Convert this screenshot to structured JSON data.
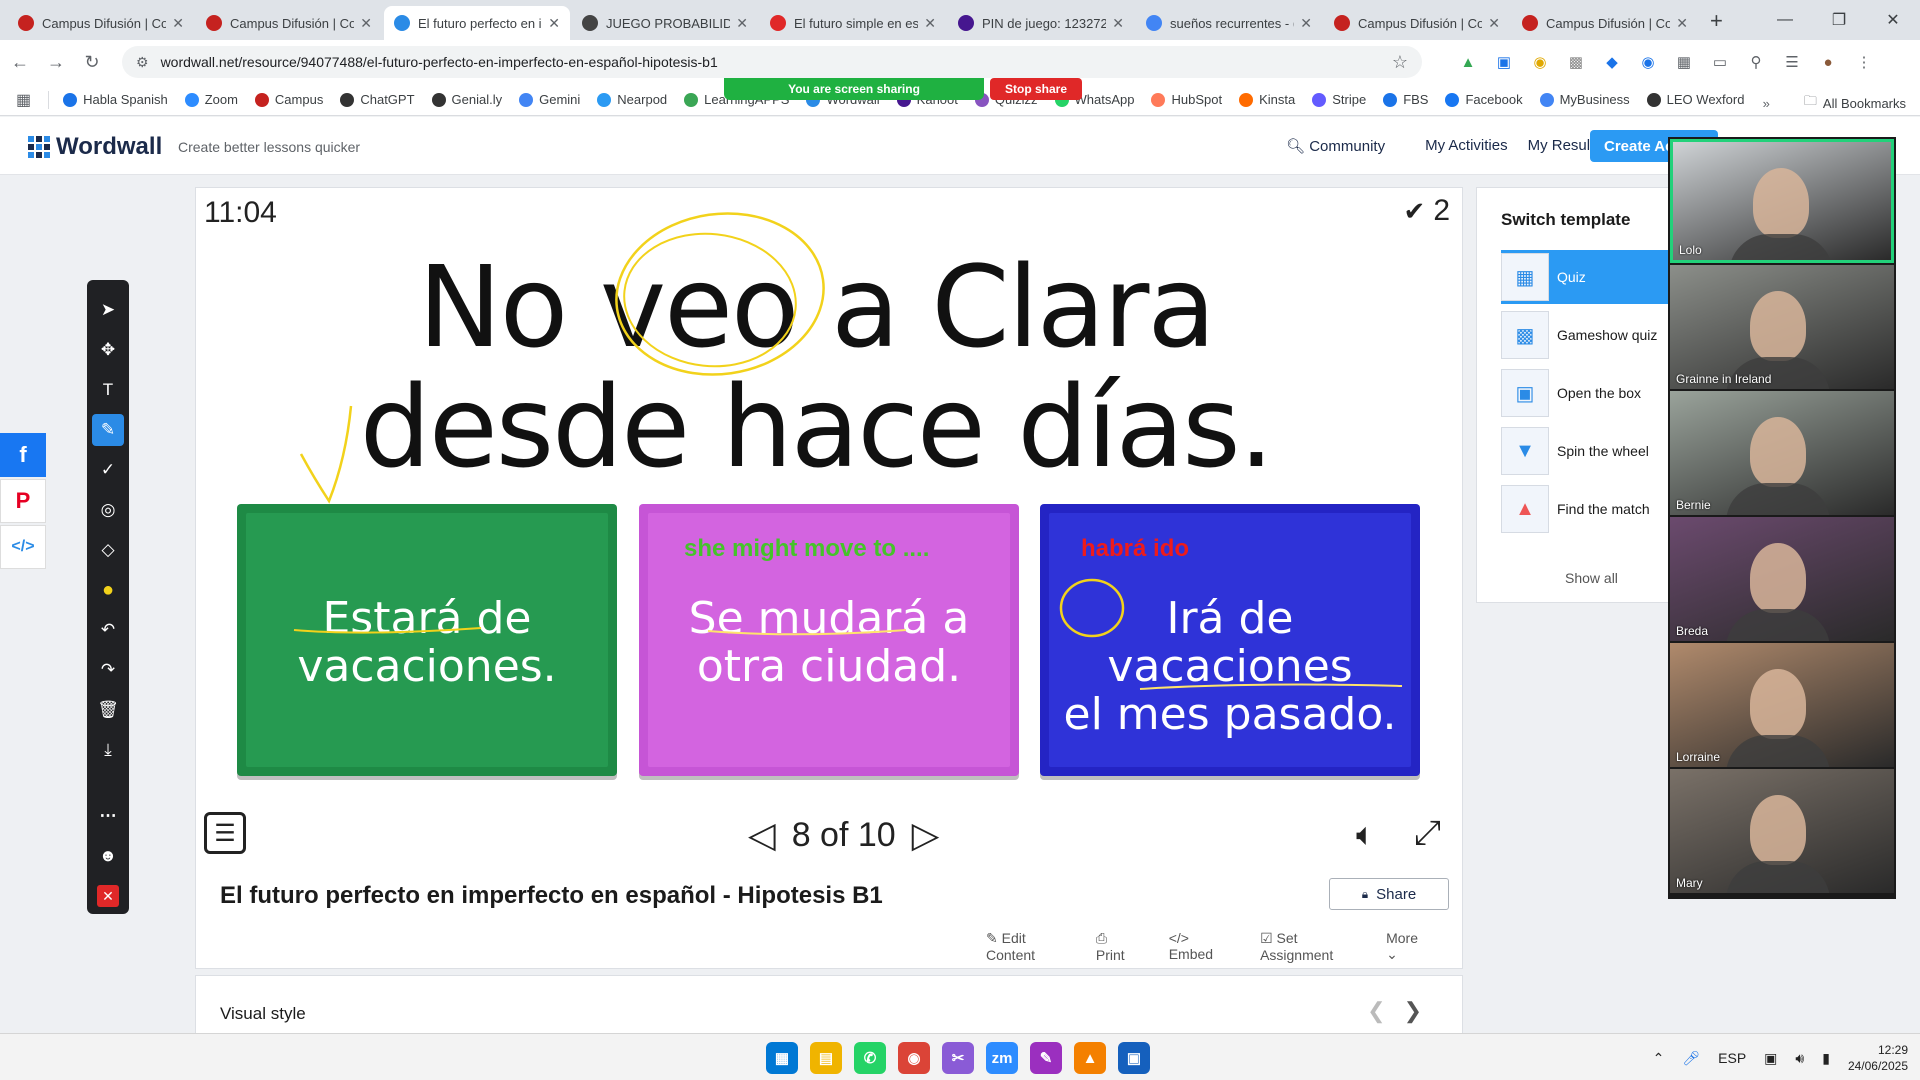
{
  "browser": {
    "tabs": [
      {
        "label": "Campus Difusión | Co",
        "color": "#c5221f",
        "active": false
      },
      {
        "label": "Campus Difusión | Co",
        "color": "#c5221f",
        "active": false
      },
      {
        "label": "El futuro perfecto en i",
        "color": "#2b8be6",
        "active": true
      },
      {
        "label": "JUEGO PROBABILIDAD",
        "color": "#444444",
        "active": false
      },
      {
        "label": "El futuro simple en es",
        "color": "#e02828",
        "active": false
      },
      {
        "label": "PIN de juego: 123272",
        "color": "#46178f",
        "active": false
      },
      {
        "label": "sueños recurrentes - (",
        "color": "#4285f4",
        "active": false
      },
      {
        "label": "Campus Difusión | Co",
        "color": "#c5221f",
        "active": false
      },
      {
        "label": "Campus Difusión | Co",
        "color": "#c5221f",
        "active": false
      }
    ],
    "url": "wordwall.net/resource/94077488/el-futuro-perfecto-en-imperfecto-en-español-hipotesis-b1",
    "bookmarks": [
      {
        "label": "Habla Spanish",
        "color": "#1a73e8"
      },
      {
        "label": "Zoom",
        "color": "#2d8cff"
      },
      {
        "label": "Campus",
        "color": "#c5221f"
      },
      {
        "label": "ChatGPT",
        "color": "#333333"
      },
      {
        "label": "Genial.ly",
        "color": "#333333"
      },
      {
        "label": "Gemini",
        "color": "#4285f4"
      },
      {
        "label": "Nearpod",
        "color": "#2b9af3"
      },
      {
        "label": "LearningAPPS",
        "color": "#3aa655"
      },
      {
        "label": "Wordwall",
        "color": "#2b8be6"
      },
      {
        "label": "Kahoot",
        "color": "#46178f"
      },
      {
        "label": "Quizizz",
        "color": "#8854c0"
      },
      {
        "label": "WhatsApp",
        "color": "#25d366"
      },
      {
        "label": "HubSpot",
        "color": "#ff7a59"
      },
      {
        "label": "Kinsta",
        "color": "#ff6b00"
      },
      {
        "label": "Stripe",
        "color": "#635bff"
      },
      {
        "label": "FBS",
        "color": "#1a73e8"
      },
      {
        "label": "Facebook",
        "color": "#1877f2"
      },
      {
        "label": "MyBusiness",
        "color": "#4285f4"
      },
      {
        "label": "LEO Wexford",
        "color": "#333333"
      }
    ],
    "all_bookmarks": "All Bookmarks",
    "screen_sharing": "You are screen sharing",
    "stop_share": "Stop share"
  },
  "wordwall": {
    "logo": "Wordwall",
    "tagline": "Create better lessons quicker",
    "nav": [
      "Community",
      "My Activities",
      "My Results"
    ],
    "create_btn": "Create Ac"
  },
  "game": {
    "timer": "11:04",
    "score": "2",
    "question": [
      "No veo a Clara",
      "desde hace días."
    ],
    "answers": [
      {
        "lines": [
          "Estará de",
          "vacaciones."
        ],
        "note": ""
      },
      {
        "lines": [
          "Se mudará a",
          "otra ciudad."
        ],
        "note": "she might move to ...."
      },
      {
        "lines": [
          "Irá de vacaciones",
          "el mes pasado."
        ],
        "note": "habrá ido"
      }
    ],
    "pager": "8 of 10",
    "colors": {
      "answer1": "#269a51",
      "answer2": "#d364e0",
      "answer3": "#2f33d8",
      "annotation": "#f2d21b"
    }
  },
  "activity": {
    "title": "El futuro perfecto en imperfecto en español - Hipotesis B1",
    "share": "Share",
    "actions": [
      "Edit Content",
      "Print",
      "Embed",
      "Set Assignment",
      "More"
    ],
    "visual_style": "Visual style"
  },
  "templates": {
    "heading": "Switch template",
    "items": [
      "Quiz",
      "Gameshow quiz",
      "Open the box",
      "Spin the wheel",
      "Find the match"
    ],
    "show_all": "Show all"
  },
  "zoom": {
    "participants": [
      {
        "name": "Lolo",
        "bg": "#cfd3d6"
      },
      {
        "name": "Grainne in Ireland",
        "bg": "#8c8f8a"
      },
      {
        "name": "Bernie",
        "bg": "#9aa39b"
      },
      {
        "name": "Breda",
        "bg": "#6b4a6e"
      },
      {
        "name": "Lorraine",
        "bg": "#b08a6c"
      },
      {
        "name": "Mary",
        "bg": "#7a7168"
      }
    ]
  },
  "taskbar": {
    "lang": "ESP",
    "time": "12:29",
    "date": "24/06/2025"
  }
}
